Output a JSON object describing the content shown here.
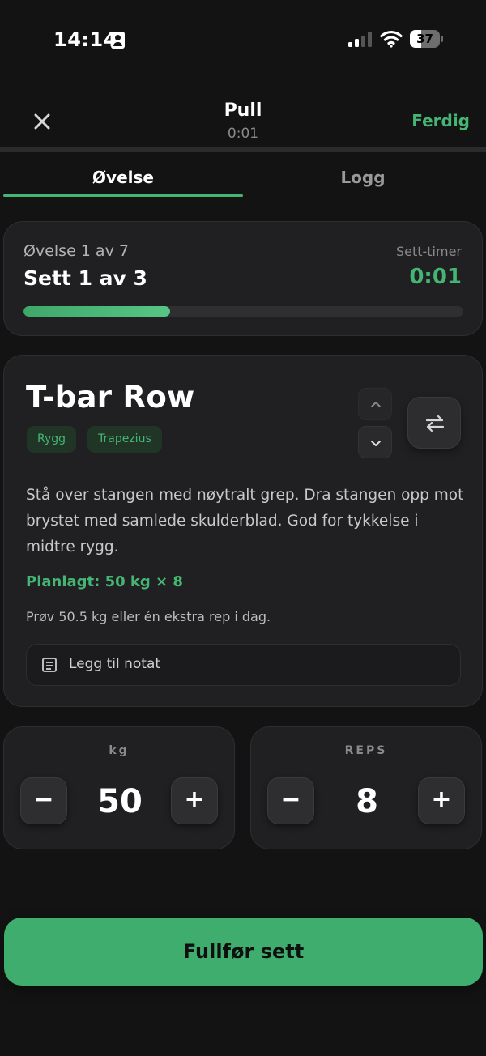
{
  "status_bar": {
    "time": "14:14",
    "battery": "37",
    "battery_level": 0.37,
    "icons": [
      "id-card-icon",
      "signal-icon",
      "wifi-icon",
      "battery-icon"
    ]
  },
  "header": {
    "title": "Pull",
    "elapsed": "0:01",
    "done_label": "Ferdig",
    "close_icon": "close-icon"
  },
  "tabs": [
    {
      "label": "Øvelse",
      "active": true
    },
    {
      "label": "Logg",
      "active": false
    }
  ],
  "progress": {
    "exercise_label": "Øvelse 1 av 7",
    "set_label": "Sett 1 av 3",
    "timer_label": "Sett-timer",
    "timer_value": "0:01",
    "fraction": 0.333
  },
  "exercise": {
    "name": "T-bar Row",
    "tags": [
      "Rygg",
      "Trapezius"
    ],
    "description": "Stå over stangen med nøytralt grep. Dra stangen opp mot brystet med samlede skulderblad. God for tykkelse i midtre rygg.",
    "planned": "Planlagt: 50 kg × 8",
    "suggestion": "Prøv 50.5 kg eller én ekstra rep i dag.",
    "note_label": "Legg til notat",
    "icons": [
      "chevron-up-icon",
      "chevron-down-icon",
      "swap-icon",
      "note-icon"
    ]
  },
  "steppers": {
    "weight": {
      "label": "kg",
      "value": "50",
      "minus": "−",
      "plus": "+"
    },
    "reps": {
      "label": "REPS",
      "value": "8",
      "minus": "−",
      "plus": "+"
    }
  },
  "complete_button": {
    "label": "Fullfør sett"
  },
  "colors": {
    "accent": "#45b574",
    "background": "#131313",
    "card": "#202022",
    "tag_bg": "#213527"
  }
}
